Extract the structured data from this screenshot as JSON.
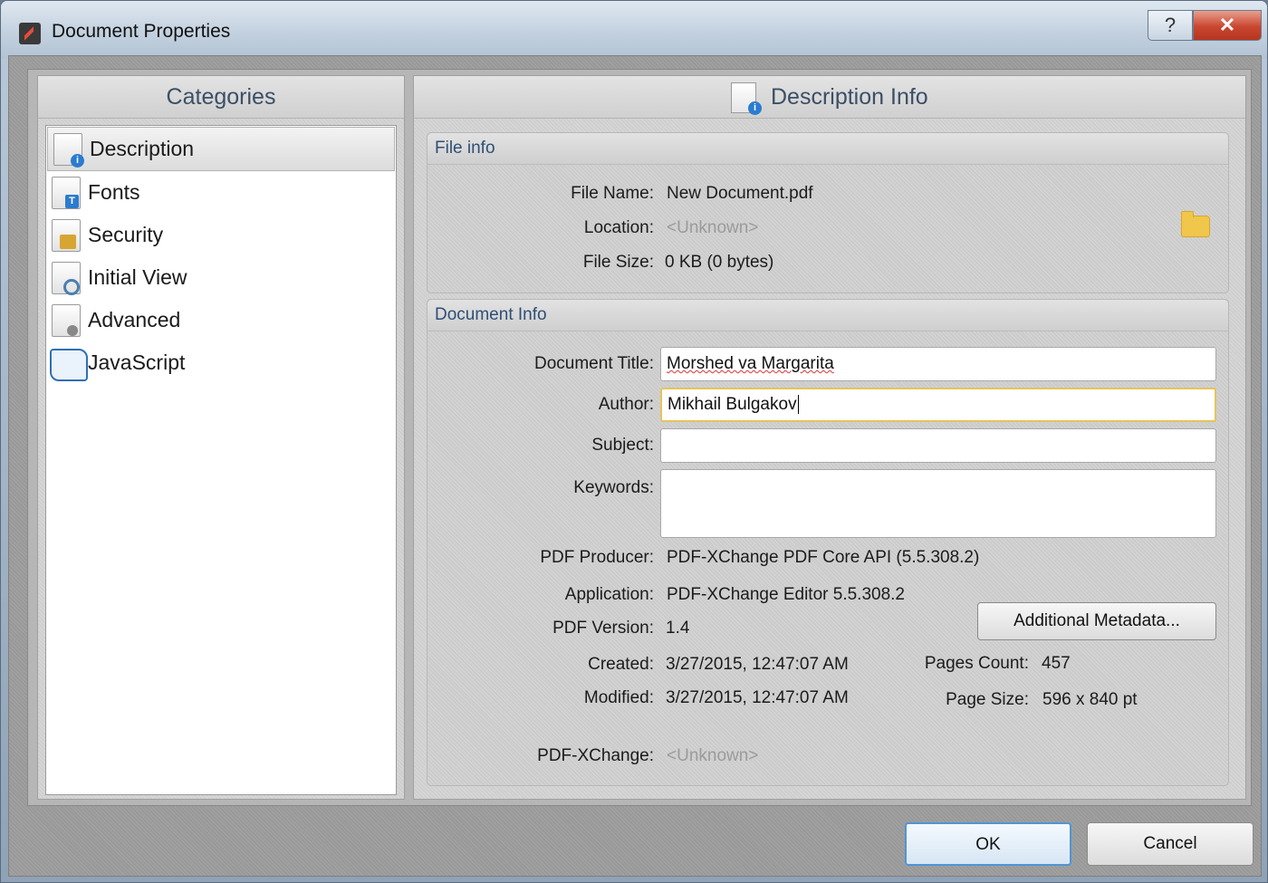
{
  "window": {
    "title": "Document Properties",
    "help_label": "?",
    "close_label": "✕"
  },
  "categories": {
    "header": "Categories",
    "items": [
      {
        "label": "Description",
        "icon": "description-icon"
      },
      {
        "label": "Fonts",
        "icon": "fonts-icon"
      },
      {
        "label": "Security",
        "icon": "lock-icon"
      },
      {
        "label": "Initial View",
        "icon": "initial-view-icon"
      },
      {
        "label": "Advanced",
        "icon": "gear-document-icon"
      },
      {
        "label": "JavaScript",
        "icon": "script-scroll-icon"
      }
    ],
    "selected": "Description"
  },
  "main": {
    "header": "Description Info",
    "file_info": {
      "title": "File info",
      "file_name_label": "File Name:",
      "file_name": "New Document.pdf",
      "location_label": "Location:",
      "location": "<Unknown>",
      "file_size_label": "File Size:",
      "file_size": "0 KB (0 bytes)"
    },
    "doc_info": {
      "title": "Document Info",
      "doc_title_label": "Document Title:",
      "doc_title": "Morshed va Margarita",
      "author_label": "Author:",
      "author": "Mikhail Bulgakov",
      "subject_label": "Subject:",
      "subject": "",
      "keywords_label": "Keywords:",
      "keywords": "",
      "producer_label": "PDF Producer:",
      "producer": "PDF-XChange PDF Core API (5.5.308.2)",
      "application_label": "Application:",
      "application": "PDF-XChange Editor 5.5.308.2",
      "version_label": "PDF Version:",
      "version": "1.4",
      "created_label": "Created:",
      "created": "3/27/2015, 12:47:07 AM",
      "modified_label": "Modified:",
      "modified": "3/27/2015, 12:47:07 AM",
      "pages_label": "Pages Count:",
      "pages": "457",
      "page_size_label": "Page Size:",
      "page_size": "596 x 840 pt",
      "pdfxchange_label": "PDF-XChange:",
      "pdfxchange": "<Unknown>",
      "metadata_button": "Additional Metadata..."
    }
  },
  "footer": {
    "ok": "OK",
    "cancel": "Cancel"
  },
  "colors": {
    "accent_focus": "#e6c35a",
    "header_text": "#3b4f66",
    "group_header_text": "#2e4f75",
    "muted_text": "#9b9b9b"
  }
}
